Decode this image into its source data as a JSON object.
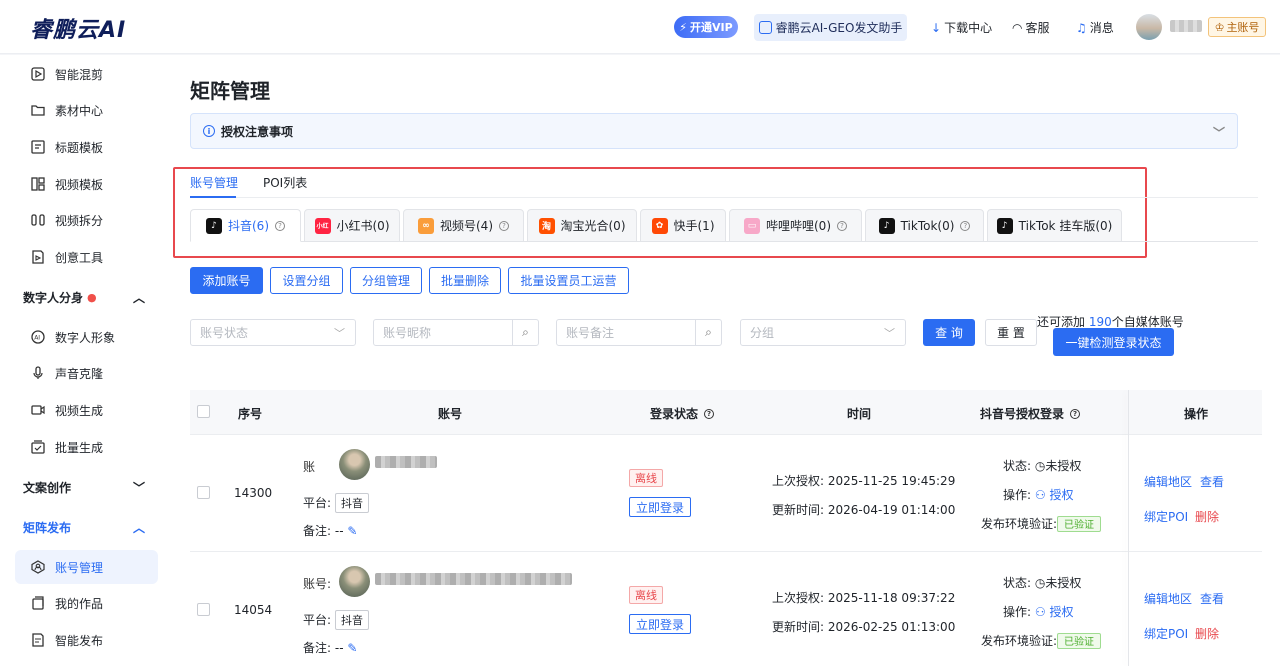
{
  "header": {
    "logo": "睿鹏云AI",
    "vip": "开通VIP",
    "assistant": "睿鹏云AI-GEO发文助手",
    "download": "下载中心",
    "service": "客服",
    "messages": "消息",
    "main_account": "主账号"
  },
  "sidebar": {
    "items_top": [
      {
        "label": "智能混剪",
        "icon": "video-edit-icon"
      },
      {
        "label": "素材中心",
        "icon": "folder-icon"
      },
      {
        "label": "标题模板",
        "icon": "template-icon"
      },
      {
        "label": "视频模板",
        "icon": "layout-icon"
      },
      {
        "label": "视频拆分",
        "icon": "split-icon"
      },
      {
        "label": "创意工具",
        "icon": "creative-icon"
      }
    ],
    "group_digital": "数字人分身",
    "items_digital": [
      {
        "label": "数字人形象",
        "icon": "ai-avatar-icon"
      },
      {
        "label": "声音克隆",
        "icon": "microphone-icon"
      },
      {
        "label": "视频生成",
        "icon": "video-camera-icon"
      },
      {
        "label": "批量生成",
        "icon": "batch-icon"
      }
    ],
    "group_copy": "文案创作",
    "group_matrix": "矩阵发布",
    "items_matrix": [
      {
        "label": "账号管理",
        "icon": "account-icon"
      },
      {
        "label": "我的作品",
        "icon": "works-icon"
      },
      {
        "label": "智能发布",
        "icon": "publish-icon"
      }
    ]
  },
  "page": {
    "title": "矩阵管理",
    "notice": "授权注意事项",
    "tabs": [
      "账号管理",
      "POI列表"
    ],
    "platform_tabs": [
      {
        "label": "抖音(6)",
        "icon": "douyin-icon",
        "help": true
      },
      {
        "label": "小红书(0)",
        "icon": "xiaohongshu-icon",
        "help": false
      },
      {
        "label": "视频号(4)",
        "icon": "shipinhao-icon",
        "help": true
      },
      {
        "label": "淘宝光合(0)",
        "icon": "taobao-icon",
        "help": false
      },
      {
        "label": "快手(1)",
        "icon": "kuaishou-icon",
        "help": false
      },
      {
        "label": "哔哩哔哩(0)",
        "icon": "bilibili-icon",
        "help": true
      },
      {
        "label": "TikTok(0)",
        "icon": "tiktok-icon",
        "help": true
      },
      {
        "label": "TikTok 挂车版(0)",
        "icon": "tiktok-shop-icon",
        "help": false
      }
    ],
    "actions": [
      "添加账号",
      "设置分组",
      "分组管理",
      "批量删除",
      "批量设置员工运营"
    ],
    "filters": {
      "status_placeholder": "账号状态",
      "nickname_placeholder": "账号昵称",
      "remark_placeholder": "账号备注",
      "group_placeholder": "分组",
      "query": "查 询",
      "reset": "重 置"
    },
    "remain_prefix": "还可添加 ",
    "remain_count": "190",
    "remain_suffix": "个自媒体账号",
    "detect": "一键检测登录状态"
  },
  "table": {
    "headers": {
      "seq": "序号",
      "account": "账号",
      "login_status": "登录状态",
      "time": "时间",
      "auth": "抖音号授权登录",
      "ops": "操作"
    },
    "rows": [
      {
        "seq": "14300",
        "account_label": "账",
        "platform_label": "平台:",
        "platform": "抖音",
        "remark_label": "备注:",
        "remark": "--",
        "status": "离线",
        "login_btn": "立即登录",
        "last_auth_label": "上次授权:",
        "last_auth": "2025-11-25 19:45:29",
        "update_label": "更新时间:",
        "update": "2026-04-19 01:14:00",
        "auth_state_label": "状态:",
        "auth_state": "未授权",
        "auth_op_label": "操作:",
        "auth_op": "授权",
        "env_label": "发布环境验证:",
        "env": "已验证",
        "op_edit": "编辑地区",
        "op_view": "查看",
        "op_bind": "绑定POI",
        "op_delete": "删除"
      },
      {
        "seq": "14054",
        "account_label": "账号:",
        "platform_label": "平台:",
        "platform": "抖音",
        "remark_label": "备注:",
        "remark": "--",
        "status": "离线",
        "login_btn": "立即登录",
        "last_auth_label": "上次授权:",
        "last_auth": "2025-11-18 09:37:22",
        "update_label": "更新时间:",
        "update": "2026-02-25 01:13:00",
        "auth_state_label": "状态:",
        "auth_state": "未授权",
        "auth_op_label": "操作:",
        "auth_op": "授权",
        "env_label": "发布环境验证:",
        "env": "已验证",
        "op_edit": "编辑地区",
        "op_view": "查看",
        "op_bind": "绑定POI",
        "op_delete": "删除"
      }
    ]
  },
  "colors": {
    "accent": "#2b6cf2",
    "danger": "#e8484d",
    "success": "#4cae2f",
    "highlight_box": "#e8484d"
  }
}
